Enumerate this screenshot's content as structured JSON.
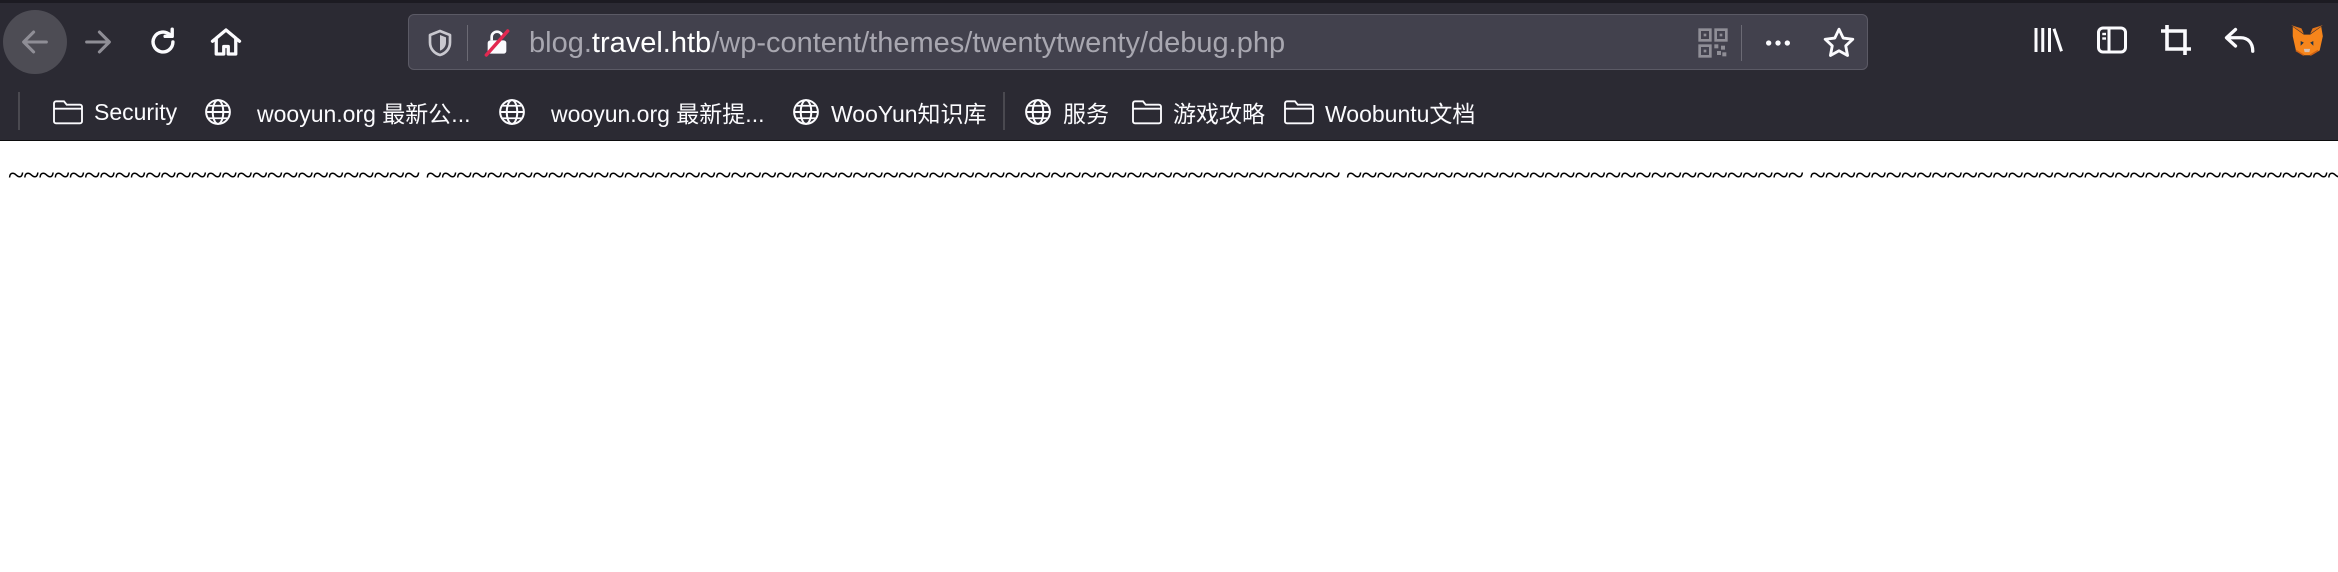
{
  "browser": {
    "url": {
      "prefix": "blog.",
      "host": "travel.htb",
      "path": "/wp-content/themes/twentytwenty/debug.php"
    },
    "toolbar_icons": [
      "back-arrow-icon",
      "forward-arrow-icon",
      "reload-icon",
      "home-icon",
      "shield-icon",
      "insecure-lock-icon",
      "qr-code-icon",
      "more-icon",
      "star-icon",
      "library-icon",
      "sidebar-icon",
      "screenshot-crop-icon",
      "undo-arrow-icon",
      "metamask-fox-icon"
    ]
  },
  "bookmarks": [
    {
      "label": "Security",
      "icon": "folder-icon"
    },
    {
      "label": "wooyun.org 最新公...",
      "icon": "globe-icon"
    },
    {
      "label": "wooyun.org 最新提...",
      "icon": "globe-icon"
    },
    {
      "label": "WooYun知识库",
      "icon": "globe-icon"
    },
    {
      "label": "服务",
      "icon": "globe-icon"
    },
    {
      "label": "游戏攻略",
      "icon": "folder-icon"
    },
    {
      "label": "Woobuntu文档",
      "icon": "folder-icon"
    }
  ],
  "page": {
    "text": "~~~~~~~~~~~~~~~~~~~~~~~~~~~ ~~~~~~~~~~~~~~~~~~~~~~~~~~~~~~~~~~~~~~~~~~~~~~~~~~~~~~~~~~~~ ~~~~~~~~~~~~~~~~~~~~~~~~~~~~~~ ~~~~~~~~~~~~~~~~~~~~~~~~~~~~~~~~~~~~~~~~~~~~~~~~~~~~~~~~~~~~~~~~"
  }
}
